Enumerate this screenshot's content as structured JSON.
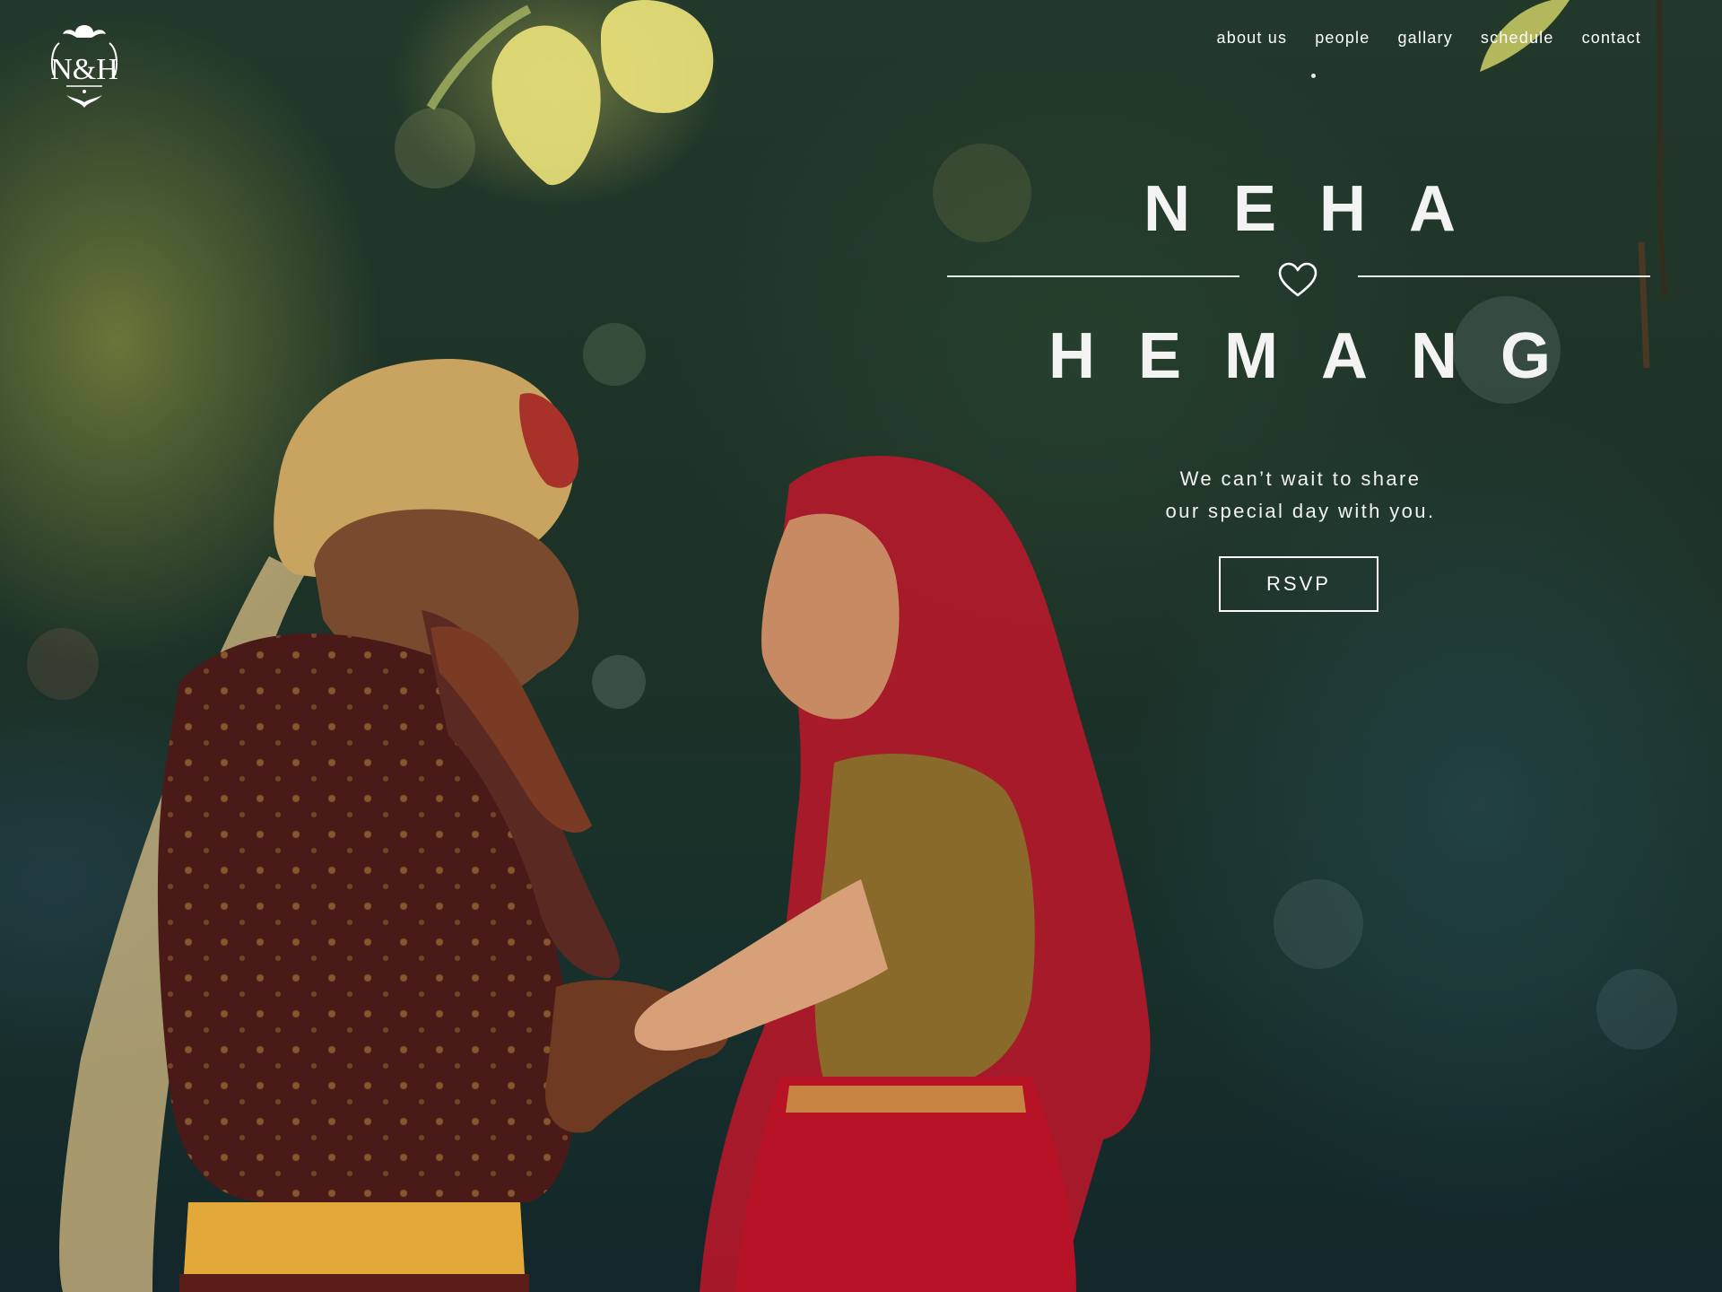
{
  "brand": {
    "monogram": "N&H"
  },
  "nav": {
    "items": [
      {
        "label": "about us"
      },
      {
        "label": "people"
      },
      {
        "label": "gallary"
      },
      {
        "label": "schedule"
      },
      {
        "label": "contact"
      }
    ]
  },
  "hero": {
    "name_primary": "NEHA",
    "name_secondary": "HEMANG",
    "divider_icon": "heart-icon",
    "tagline_line1": "We can’t wait to share",
    "tagline_line2": "our special day with you.",
    "rsvp_label": "RSVP"
  },
  "colors": {
    "text": "#ffffff",
    "background_dark": "#1d3227"
  }
}
